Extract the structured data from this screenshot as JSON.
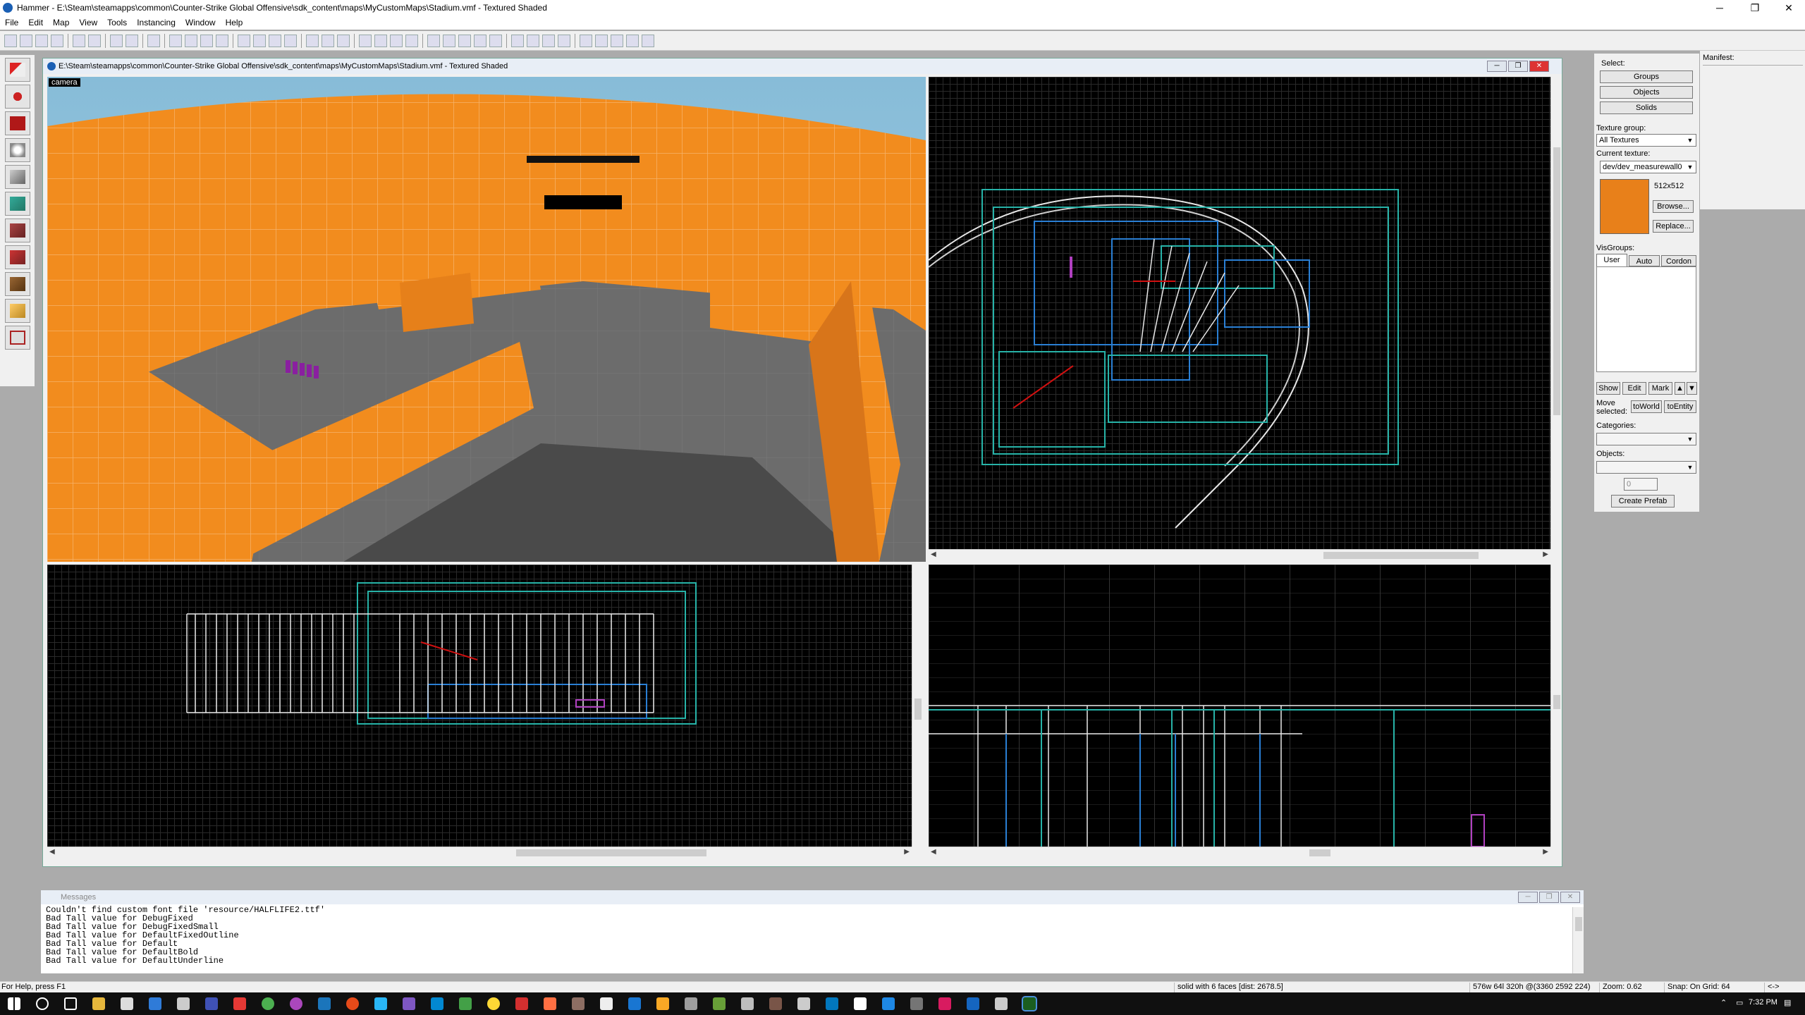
{
  "window": {
    "title": "Hammer - E:\\Steam\\steamapps\\common\\Counter-Strike Global Offensive\\sdk_content\\maps\\MyCustomMaps\\Stadium.vmf - Textured Shaded",
    "minimize": "─",
    "maximize": "❐",
    "close": "✕"
  },
  "menu": [
    "File",
    "Edit",
    "Map",
    "View",
    "Tools",
    "Instancing",
    "Window",
    "Help"
  ],
  "document": {
    "title": "E:\\Steam\\steamapps\\common\\Counter-Strike Global Offensive\\sdk_content\\maps\\MyCustomMaps\\Stadium.vmf - Textured Shaded",
    "minimize": "─",
    "restore": "❐",
    "close": "✕"
  },
  "viewports": {
    "camera_label": "camera"
  },
  "right_panel": {
    "select_label": "Select:",
    "groups": "Groups",
    "objects": "Objects",
    "solids": "Solids",
    "texture_group_label": "Texture group:",
    "texture_group_value": "All Textures",
    "current_texture_label": "Current texture:",
    "current_texture_value": "dev/dev_measurewall0",
    "texture_size": "512x512",
    "browse": "Browse...",
    "replace": "Replace...",
    "visgroups_label": "VisGroups:",
    "tab_user": "User",
    "tab_auto": "Auto",
    "tab_cordon": "Cordon",
    "show": "Show",
    "edit": "Edit",
    "mark": "Mark",
    "move_selected": "Move selected:",
    "to_world": "toWorld",
    "to_entity": "toEntity",
    "categories_label": "Categories:",
    "objects_label": "Objects:",
    "spinner_value": "0",
    "create_prefab": "Create Prefab",
    "texture_color": "#e8801a"
  },
  "manifest": {
    "label": "Manifest:"
  },
  "messages": {
    "title": "Messages",
    "lines": [
      "Couldn't find custom font file 'resource/HALFLIFE2.ttf'",
      "Bad Tall value for DebugFixed",
      "Bad Tall value for DebugFixedSmall",
      "Bad Tall value for DefaultFixedOutline",
      "Bad Tall value for Default",
      "Bad Tall value for DefaultBold",
      "Bad Tall value for DefaultUnderline"
    ]
  },
  "statusbar": {
    "help": "For Help, press F1",
    "selection": "solid with 6 faces  [dist: 2678.5]",
    "size": "576w 64l 320h @(3360 2592 224)",
    "zoom": "Zoom: 0.62",
    "snap": "Snap: On Grid: 64",
    "arrows": "<->"
  },
  "taskbar": {
    "time": "7:32 PM"
  },
  "colors": {
    "wall_orange": "#f28c1e",
    "floor_gray": "#6e6e6e",
    "sky": "#9fcbe0",
    "wire_white": "#e8e8e8",
    "wire_cyan": "#27b3a8",
    "wire_blue": "#2a7fd4",
    "selection_red": "#d01010",
    "entity_magenta": "#b040c0"
  }
}
